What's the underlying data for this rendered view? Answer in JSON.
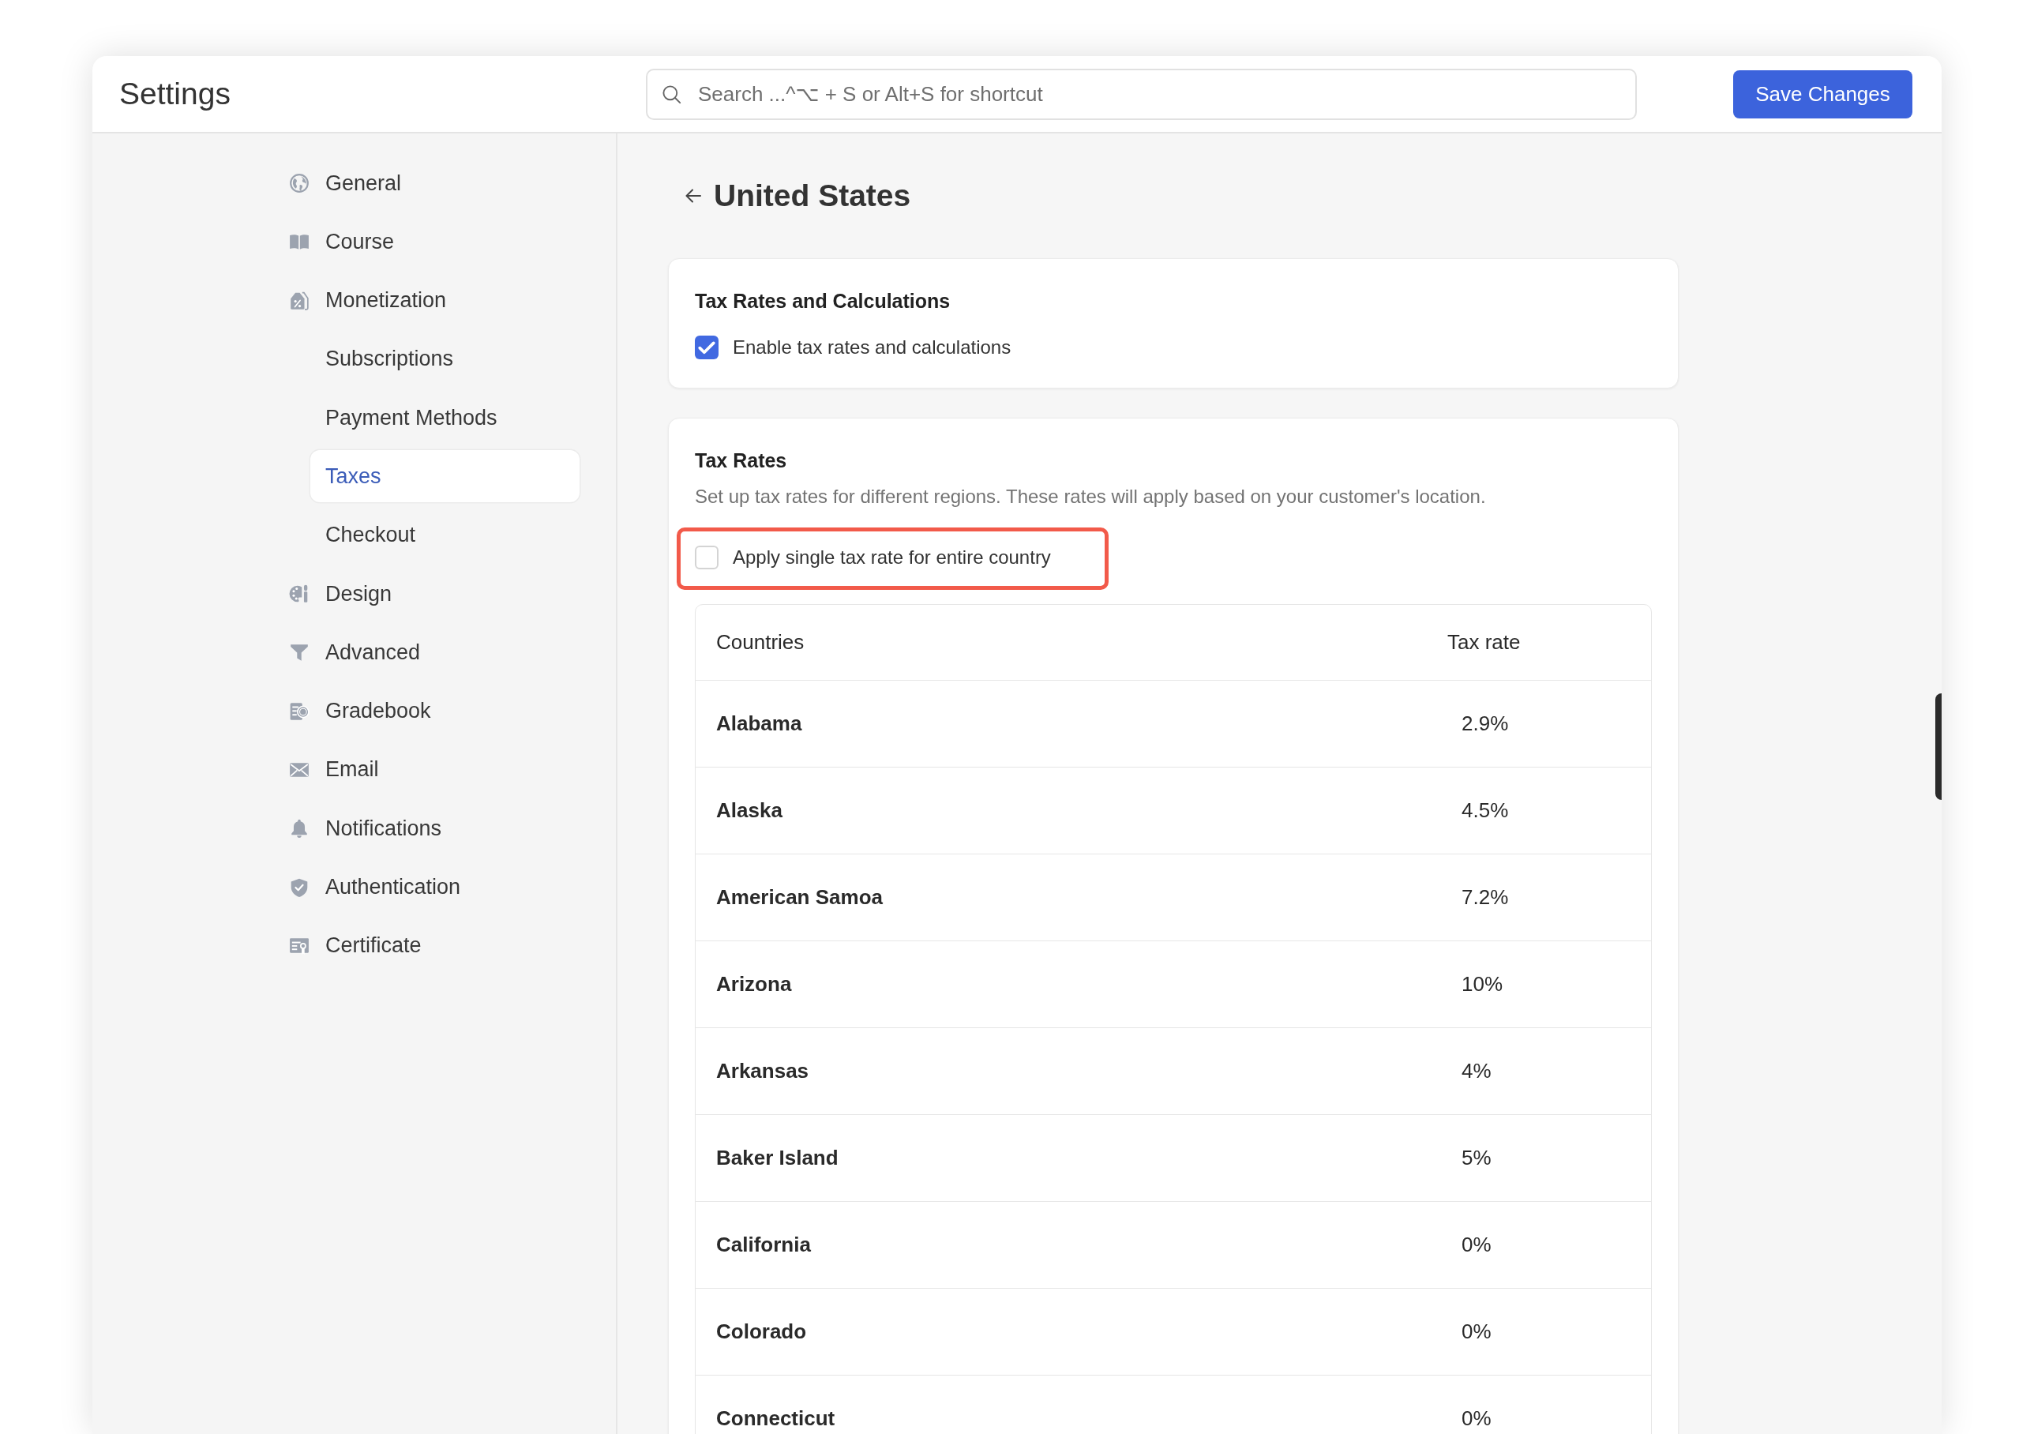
{
  "window": {
    "title": "Settings"
  },
  "search": {
    "placeholder": "Search ...^⌥ + S or Alt+S for shortcut"
  },
  "save_button": "Save Changes",
  "sidebar": {
    "items": [
      {
        "label": "General",
        "selected": false
      },
      {
        "label": "Course",
        "selected": false
      },
      {
        "label": "Monetization",
        "selected": false,
        "children": [
          {
            "label": "Subscriptions",
            "selected": false
          },
          {
            "label": "Payment Methods",
            "selected": false
          },
          {
            "label": "Taxes",
            "selected": true
          },
          {
            "label": "Checkout",
            "selected": false
          }
        ]
      },
      {
        "label": "Design",
        "selected": false
      },
      {
        "label": "Advanced",
        "selected": false
      },
      {
        "label": "Gradebook",
        "selected": false
      },
      {
        "label": "Email",
        "selected": false
      },
      {
        "label": "Notifications",
        "selected": false
      },
      {
        "label": "Authentication",
        "selected": false
      },
      {
        "label": "Certificate",
        "selected": false
      }
    ]
  },
  "page": {
    "title": "United States"
  },
  "tax_calculations": {
    "title": "Tax Rates and Calculations",
    "option": {
      "label": "Enable tax rates and calculations",
      "checked": true
    }
  },
  "tax_rates": {
    "title": "Tax Rates",
    "description": "Set up tax rates for different regions. These rates will apply based on your customer's location.",
    "option": {
      "label": "Apply single tax rate for entire country",
      "checked": false,
      "highlighted": true
    },
    "table": {
      "columns": [
        "Countries",
        "Tax rate"
      ],
      "rows": [
        [
          "Alabama",
          "2.9%"
        ],
        [
          "Alaska",
          "4.5%"
        ],
        [
          "American Samoa",
          "7.2%"
        ],
        [
          "Arizona",
          "10%"
        ],
        [
          "Arkansas",
          "4%"
        ],
        [
          "Baker Island",
          "5%"
        ],
        [
          "California",
          "0%"
        ],
        [
          "Colorado",
          "0%"
        ],
        [
          "Connecticut",
          "0%"
        ]
      ]
    }
  }
}
